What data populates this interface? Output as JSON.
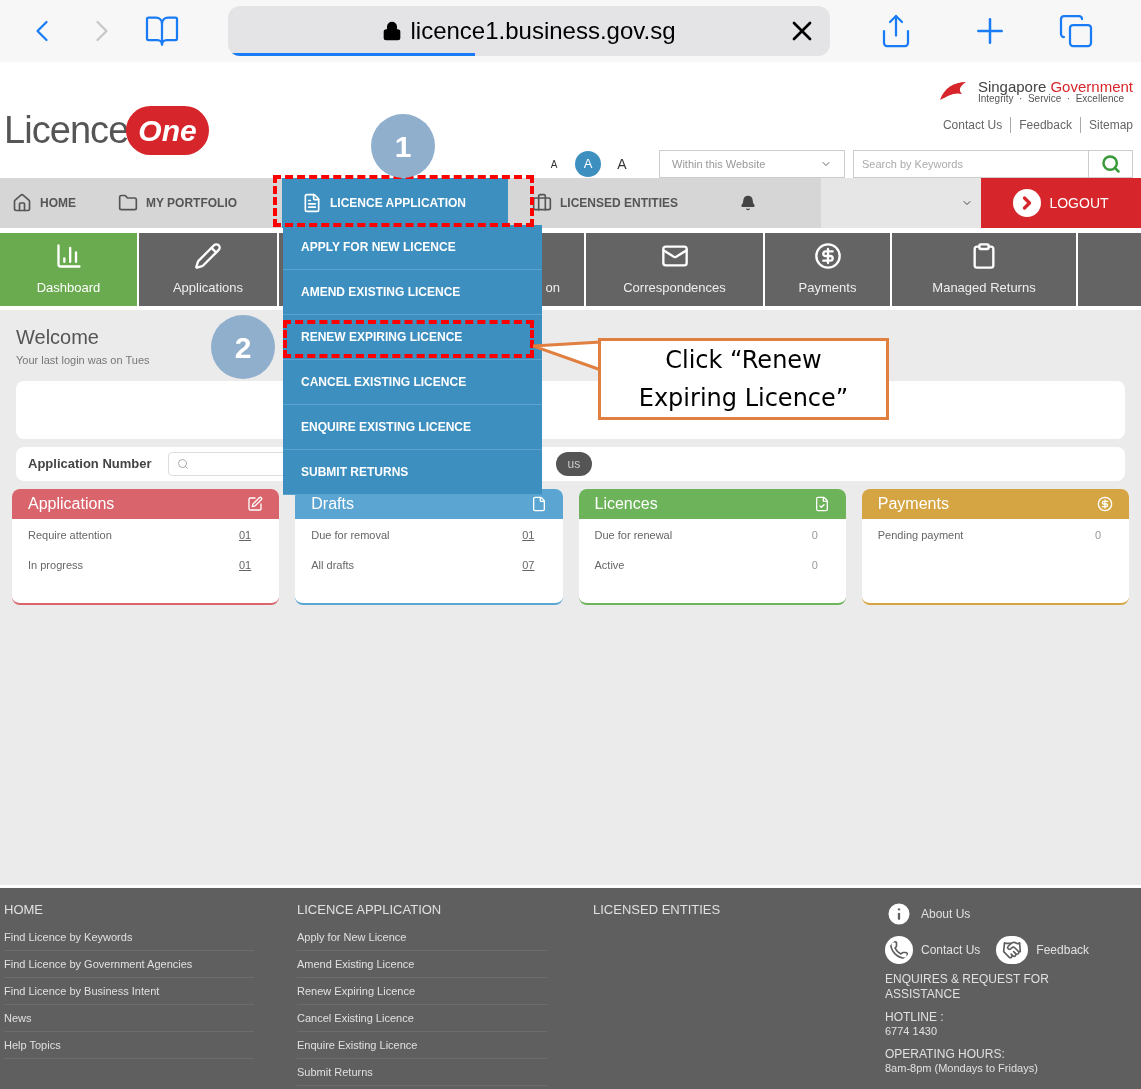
{
  "browser": {
    "url": "licence1.business.gov.sg",
    "forward_disabled": true,
    "level": 0.41
  },
  "header": {
    "logo": {
      "word": "Licence",
      "badge": "One"
    },
    "gov": {
      "name": "Singapore",
      "name_accent": "Government",
      "motto": "Integrity  ·  Service  ·  Excellence"
    },
    "links": [
      "Contact Us",
      "Feedback",
      "Sitemap"
    ],
    "font_sizes": [
      {
        "label": "A",
        "selected": false
      },
      {
        "label": "A",
        "selected": true
      },
      {
        "label": "A",
        "selected": false
      }
    ],
    "scope_select": "Within this Website",
    "search": {
      "placeholder": "Search by Keywords"
    }
  },
  "nav": [
    {
      "label": "HOME",
      "kind": "home",
      "selected": false
    },
    {
      "label": "MY PORTFOLIO",
      "kind": "folder",
      "selected": false
    },
    {
      "label": "LICENCE APPLICATION",
      "kind": "form",
      "selected": true
    },
    {
      "label": "LICENSED ENTITIES",
      "kind": "briefcase",
      "selected": false
    }
  ],
  "logout": "LOGOUT",
  "tiles": [
    {
      "label": "Dashboard",
      "kind": "chart",
      "selected": true
    },
    {
      "label": "Applications",
      "kind": "pencil",
      "selected": false
    },
    {
      "label": "on",
      "kind": "none",
      "selected": false
    },
    {
      "label": "Correspondences",
      "kind": "mail",
      "selected": false
    },
    {
      "label": "Payments",
      "kind": "moneybag",
      "selected": false
    },
    {
      "label": "Managed Returns",
      "kind": "clipboard",
      "selected": false
    },
    {
      "kind": "none",
      "selected": false
    }
  ],
  "welcome": {
    "title": "Welcome",
    "last_login": "Your last login was on Tues"
  },
  "search_row": {
    "label": "Application Number",
    "button": "us"
  },
  "cards": [
    {
      "title": "Applications",
      "color": "#d9646c",
      "kind": "edit",
      "rows": [
        {
          "label": "Require attention",
          "value": "01",
          "link": true
        },
        {
          "label": "In progress",
          "value": "01",
          "link": true
        }
      ]
    },
    {
      "title": "Drafts",
      "color": "#5aa5d2",
      "kind": "doc",
      "rows": [
        {
          "label": "Due for removal",
          "value": "01",
          "link": true
        },
        {
          "label": "All drafts",
          "value": "07",
          "link": true
        }
      ]
    },
    {
      "title": "Licences",
      "color": "#6cb35a",
      "kind": "licence",
      "rows": [
        {
          "label": "Due for renewal",
          "value": "0",
          "link": false
        },
        {
          "label": "Active",
          "value": "0",
          "link": false
        }
      ]
    },
    {
      "title": "Payments",
      "color": "#d5a543",
      "kind": "money",
      "rows": [
        {
          "label": "Pending payment",
          "value": "0",
          "link": false
        }
      ]
    }
  ],
  "dropdown": [
    {
      "label": "APPLY FOR NEW LICENCE"
    },
    {
      "label": "AMEND EXISTING LICENCE"
    },
    {
      "label": "RENEW EXPIRING LICENCE"
    },
    {
      "label": "CANCEL EXISTING LICENCE"
    },
    {
      "label": "ENQUIRE EXISTING LICENCE"
    },
    {
      "label": "SUBMIT RETURNS"
    }
  ],
  "annotations": {
    "step_1": "1",
    "step_2": "2",
    "callout": "Click “Renew Expiring Licence”"
  },
  "footer": {
    "columns": [
      {
        "heading": "HOME",
        "items": [
          "Find Licence by Keywords",
          "Find Licence by Government Agencies",
          "Find Licence by Business Intent",
          "News",
          "Help Topics"
        ]
      },
      {
        "heading": "LICENCE APPLICATION",
        "items": [
          "Apply for New Licence",
          "Amend Existing Licence",
          "Renew Expiring Licence",
          "Cancel Existing Licence",
          "Enquire Existing Licence",
          "Submit Returns"
        ]
      },
      {
        "heading": "LICENSED ENTITIES"
      }
    ],
    "about": "About Us",
    "contact": "Contact Us",
    "feedback": "Feedback",
    "info": [
      {
        "label": "ENQUIRES & REQUEST FOR ASSISTANCE"
      },
      {
        "label": "HOTLINE :",
        "value": "6774 1430"
      },
      {
        "label": "OPERATING HOURS:",
        "value": "8am-8pm (Mondays to Fridays)"
      }
    ]
  }
}
